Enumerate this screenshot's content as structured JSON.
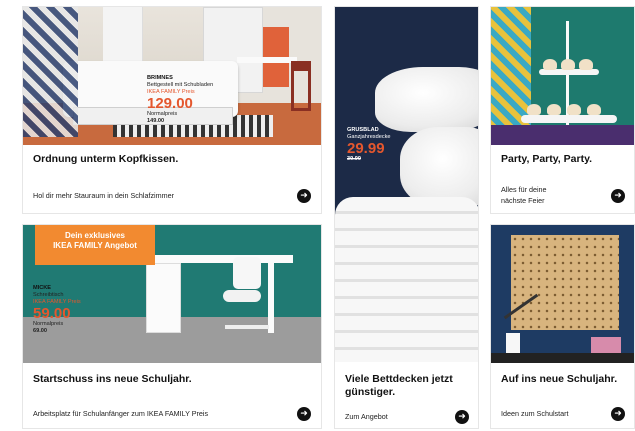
{
  "cards": [
    {
      "title": "Ordnung unterm Kopfkissen.",
      "link": "Hol dir mehr Stauraum in dein Schlafzimmer",
      "price_tag": {
        "name": "BRIMNES",
        "desc": "Bettgestell mit Schubladen",
        "family_label": "IKEA FAMILY Preis",
        "price": "129.00",
        "normal_label": "Normalpreis",
        "normal_price": "149.00"
      }
    },
    {
      "title": "Viele Bettdecken jetzt günstiger.",
      "link": "Zum Angebot",
      "price_tag": {
        "name": "GRUSBLAD",
        "desc": "Ganzjahresdecke",
        "price": "29.99",
        "old_price": "39.99"
      }
    },
    {
      "title": "Party, Party, Party.",
      "link_line1": "Alles für deine",
      "link_line2": "nächste Feier"
    },
    {
      "title": "Startschuss ins neue Schuljahr.",
      "link": "Arbeitsplatz für Schulanfänger zum IKEA FAMILY Preis",
      "banner_line1": "Dein exklusives",
      "banner_line2": "IKEA FAMILY Angebot",
      "price_tag": {
        "name": "MICKE",
        "desc": "Schreibtisch",
        "family_label": "IKEA FAMILY Preis",
        "price": "59.00",
        "normal_label": "Normalpreis",
        "normal_price": "69.00"
      }
    },
    {
      "title": "Auf ins neue Schuljahr.",
      "link": "Ideen zum Schulstart"
    }
  ],
  "icons": {
    "arrow": "arrow-right-circle-icon",
    "arrow_glyph": "➜"
  },
  "colors": {
    "price_orange": "#e4572e",
    "banner_orange": "#f28a30",
    "dark_navy": "#1c2a47"
  }
}
